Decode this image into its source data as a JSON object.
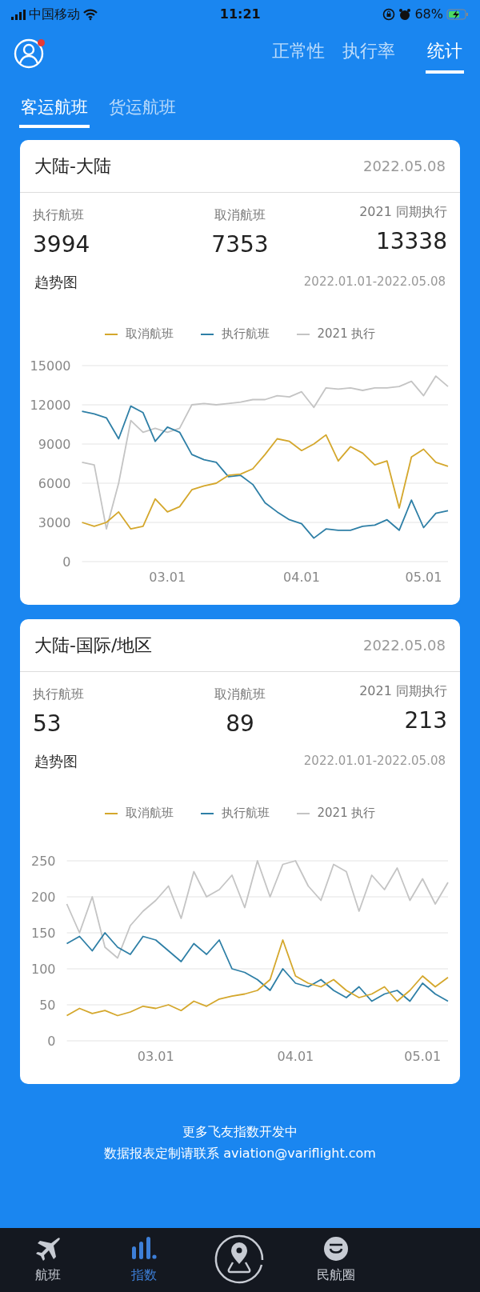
{
  "status_bar": {
    "carrier": "中国移动",
    "time": "11:21",
    "battery": "68%"
  },
  "header": {
    "notification_dot": true,
    "tabs": [
      {
        "label": "正常性",
        "selected": false
      },
      {
        "label": "执行率",
        "selected": false
      },
      {
        "label": "统计",
        "selected": true
      }
    ]
  },
  "sub_tabs": [
    {
      "label": "客运航班",
      "selected": true
    },
    {
      "label": "货运航班",
      "selected": false
    }
  ],
  "cards": [
    {
      "title": "大陆-大陆",
      "date": "2022.05.08",
      "stats": [
        {
          "label": "执行航班",
          "value": "3994"
        },
        {
          "label": "取消航班",
          "value": "7353"
        },
        {
          "label": "2021 同期执行",
          "value": "13338"
        }
      ],
      "trend_title": "趋势图",
      "range": "2022.01.01-2022.05.08",
      "chart_data": {
        "type": "line",
        "categories": [
          null,
          null,
          null,
          null,
          null,
          null,
          null,
          "03.01",
          null,
          null,
          null,
          null,
          null,
          null,
          null,
          null,
          null,
          null,
          "04.01",
          null,
          null,
          null,
          null,
          null,
          null,
          null,
          null,
          null,
          "05.01",
          null,
          null
        ],
        "grid": true,
        "legend": "top",
        "ylim": [
          0,
          15000
        ],
        "yticks": [
          0,
          3000,
          6000,
          9000,
          12000,
          15000
        ],
        "series": [
          {
            "name": "取消航班",
            "color": "#d4a72c",
            "values": [
              3000,
              2700,
              3000,
              3800,
              2500,
              2700,
              4800,
              3800,
              4200,
              5500,
              5800,
              6000,
              6600,
              6700,
              7100,
              8200,
              9400,
              9200,
              8500,
              9000,
              9700,
              7700,
              8800,
              8300,
              7400,
              7700,
              4100,
              8000,
              8600,
              7600,
              7300
            ]
          },
          {
            "name": "执行航班",
            "color": "#2e7fa6",
            "values": [
              11500,
              11300,
              11000,
              9400,
              11900,
              11400,
              9200,
              10300,
              9900,
              8200,
              7800,
              7600,
              6500,
              6600,
              5900,
              4500,
              3800,
              3200,
              2900,
              1800,
              2500,
              2400,
              2400,
              2700,
              2800,
              3200,
              2400,
              4700,
              2600,
              3700,
              3900
            ]
          },
          {
            "name": "2021 执行",
            "color": "#c4c4c4",
            "values": [
              7600,
              7400,
              2500,
              6000,
              10800,
              9900,
              10200,
              9900,
              10200,
              12000,
              12100,
              12000,
              12100,
              12200,
              12400,
              12400,
              12700,
              12600,
              13000,
              11800,
              13300,
              13200,
              13300,
              13100,
              13300,
              13300,
              13400,
              13800,
              12700,
              14200,
              13400
            ]
          }
        ]
      }
    },
    {
      "title": "大陆-国际/地区",
      "date": "2022.05.08",
      "stats": [
        {
          "label": "执行航班",
          "value": "53"
        },
        {
          "label": "取消航班",
          "value": "89"
        },
        {
          "label": "2021 同期执行",
          "value": "213"
        }
      ],
      "trend_title": "趋势图",
      "range": "2022.01.01-2022.05.08",
      "chart_data": {
        "type": "line",
        "categories": [
          null,
          null,
          null,
          null,
          null,
          null,
          null,
          "03.01",
          null,
          null,
          null,
          null,
          null,
          null,
          null,
          null,
          null,
          null,
          "04.01",
          null,
          null,
          null,
          null,
          null,
          null,
          null,
          null,
          null,
          "05.01",
          null,
          null
        ],
        "grid": true,
        "legend": "top",
        "ylim": [
          0,
          250
        ],
        "yticks": [
          0,
          50,
          100,
          150,
          200,
          250
        ],
        "series": [
          {
            "name": "取消航班",
            "color": "#d4a72c",
            "values": [
              35,
              45,
              38,
              42,
              35,
              40,
              48,
              45,
              50,
              42,
              55,
              48,
              58,
              62,
              65,
              70,
              85,
              140,
              90,
              80,
              75,
              85,
              70,
              60,
              65,
              75,
              55,
              70,
              90,
              75,
              88
            ]
          },
          {
            "name": "执行航班",
            "color": "#2e7fa6",
            "values": [
              135,
              145,
              125,
              150,
              130,
              120,
              145,
              140,
              125,
              110,
              135,
              120,
              140,
              100,
              95,
              85,
              70,
              100,
              80,
              75,
              85,
              70,
              60,
              75,
              55,
              65,
              70,
              55,
              80,
              65,
              55
            ]
          },
          {
            "name": "2021 执行",
            "color": "#c4c4c4",
            "values": [
              190,
              150,
              200,
              130,
              115,
              160,
              180,
              195,
              215,
              170,
              235,
              200,
              210,
              230,
              185,
              250,
              200,
              245,
              250,
              215,
              195,
              245,
              235,
              180,
              230,
              210,
              240,
              195,
              225,
              190,
              220
            ]
          }
        ]
      }
    }
  ],
  "footer": [
    "更多飞友指数开发中",
    "数据报表定制请联系 aviation@variflight.com"
  ],
  "bottom_nav": [
    {
      "label": "航班",
      "kind": "plane",
      "selected": false
    },
    {
      "label": "指数",
      "kind": "bars",
      "selected": true
    },
    {
      "kind": "locate",
      "selected": false
    },
    {
      "label": "民航圈",
      "kind": "smile",
      "selected": false
    }
  ]
}
